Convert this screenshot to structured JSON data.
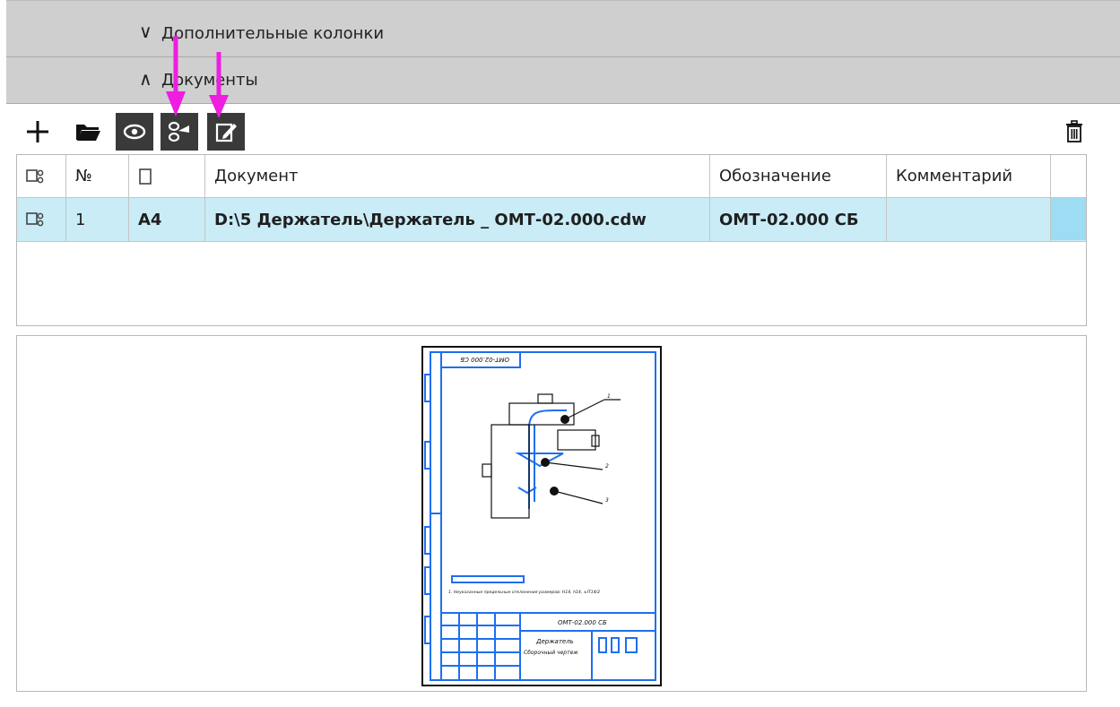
{
  "sections": {
    "extra_columns": {
      "label": "Дополнительные колонки",
      "state": "collapsed"
    },
    "documents": {
      "label": "Документы",
      "state": "expanded"
    }
  },
  "toolbar": {
    "buttons": [
      {
        "name": "add",
        "icon": "plus-icon"
      },
      {
        "name": "open",
        "icon": "folder-icon"
      },
      {
        "name": "view",
        "icon": "eye-icon"
      },
      {
        "name": "link",
        "icon": "link-icon"
      },
      {
        "name": "edit",
        "icon": "edit-document-icon"
      },
      {
        "name": "delete",
        "icon": "trash-icon"
      }
    ]
  },
  "table": {
    "headers": {
      "no": "№",
      "document": "Документ",
      "designation": "Обозначение",
      "comment": "Комментарий"
    },
    "rows": [
      {
        "no": "1",
        "format": "А4",
        "document": "D:\\5 Держатель\\Держатель _ ОМТ-02.000.cdw",
        "designation": "ОМТ-02.000 СБ",
        "comment": ""
      }
    ]
  },
  "preview": {
    "stamp_code_top": "ОМТ-02.000 СБ",
    "stamp_code": "ОМТ-02.000 СБ",
    "stamp_title": "Держатель",
    "stamp_subtitle": "Сборочный чертеж",
    "callouts": [
      "1",
      "2",
      "3"
    ],
    "note": "1. Неуказанные предельные отклонения размеров: H14, h14, ±IT14/2"
  },
  "colors": {
    "section_header_bg": "#cfcfcf",
    "selected_row": "#c9ecf7",
    "selected_row_tail": "#9ddcf3",
    "toolbar_toggle_bg": "#3a3a3a",
    "drawing_blue": "#1e6ff0",
    "annotation_arrow": "#ee1ee0"
  }
}
